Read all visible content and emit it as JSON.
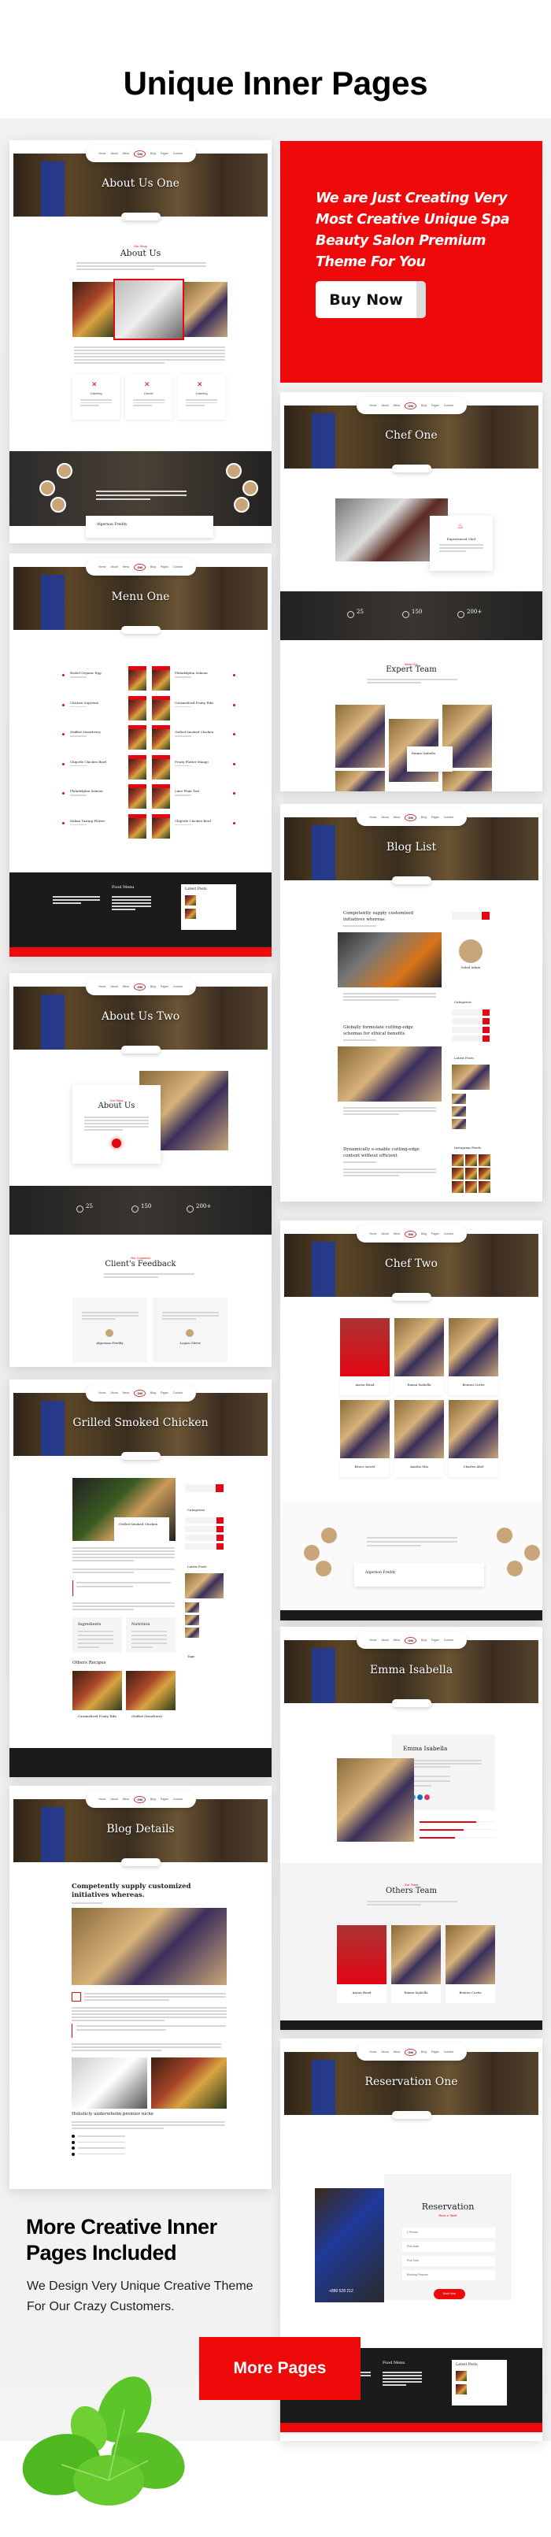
{
  "header": {
    "title": "Unique Inner Pages"
  },
  "promo": {
    "text": "We are Just Creating Very Most Creative Unique Spa Beauty Salon Premium Theme For You",
    "button": "Buy Now",
    "color": "#ee0a0a"
  },
  "nav": [
    "Home",
    "About",
    "Menu",
    "Blog",
    "Pages",
    "Contact"
  ],
  "pages": {
    "about_one": {
      "title": "About Us One",
      "tag": "Our Story",
      "heading": "About Us",
      "features": [
        "Catering",
        "Dinner",
        "Catering"
      ],
      "person": "Algernon Freddy"
    },
    "menu_one": {
      "title": "Menu One",
      "left_items": [
        "Boiled Organic Egg",
        "Chicken Supreme",
        "Stuffed Strawberry",
        "Chipotle Chicken Bowl",
        "Philadelphia Salmon",
        "Italian Tasting Platter"
      ],
      "right_items": [
        "Philadelphia Salmon",
        "Caramelized Fruity Ribs",
        "Grilled Smoked Chicken",
        "Fruity Platter Mango",
        "Lime Plum Tart",
        "Chipotle Chicken Bowl"
      ],
      "footer_menu": "Food Menu",
      "footer_posts": "Latest Posts"
    },
    "about_two": {
      "title": "About Us Two",
      "tag": "Our Story",
      "heading": "About Us",
      "stats": [
        "25",
        "150",
        "200+"
      ],
      "feedback_tag": "Our Customer",
      "feedback": "Client's Feedback",
      "people": [
        "Algernon Freddy",
        "Logan Oliver"
      ]
    },
    "grilled": {
      "title": "Grilled Smoked Chicken",
      "card_title": "Grilled Smoked Chicken",
      "categories": "Categories",
      "latest": "Latest Posts",
      "tags": "Tags",
      "ingredients": "Ingredients",
      "nutrition": "Nutrition",
      "others": "Others Recipes",
      "recipes": [
        "Caramelized Fruity Ribs",
        "Stuffed Strawberry"
      ],
      "footer_menu": "Food Menu",
      "footer_posts": "Latest Posts"
    },
    "blog_details": {
      "title": "Blog Details",
      "heading": "Competently supply customized initiatives whereas.",
      "subheading": "Holisticly underwhelm premier niche"
    },
    "chef_one": {
      "title": "Chef One",
      "card": "Experienced Chef",
      "stats": [
        "25",
        "150",
        "200+"
      ],
      "team_tag": "Meet Our",
      "team": "Expert Team",
      "featured": "Emma Isabella"
    },
    "blog_list": {
      "title": "Blog List",
      "posts": [
        "Competently supply customized initiatives whereas",
        "Globally formulate cutting-edge schemas for ethical benefits",
        "Dynamically e-enable cutting-edge content without efficient"
      ],
      "author": "Sohel Adam",
      "categories": "Categories",
      "latest": "Latest Posts",
      "instagram": "Instagram Feeds"
    },
    "chef_two": {
      "title": "Chef Two",
      "chefs": [
        "Aaron Bond",
        "Emma Isabella",
        "Benton Curtis",
        "Bruce Aewel",
        "Amelia Mia",
        "Charles Abel"
      ],
      "person": "Algernon Freddy"
    },
    "emma": {
      "title": "Emma Isabella",
      "name": "Emma Isabella",
      "skills": [
        75,
        58,
        47
      ],
      "team_tag": "Our Team",
      "team": "Others Team",
      "chefs": [
        "Aaron Bond",
        "Emma Isabella",
        "Benton Curtis"
      ]
    },
    "reservation": {
      "title": "Reservation One",
      "heading": "Reservation",
      "tag": "Book a Table",
      "fields": [
        "2 Person",
        "Pick Date",
        "Pick Time",
        "Booking Purpose"
      ],
      "button": "Book Now",
      "phone": "+880 528 212",
      "footer_menu": "Food Menu",
      "footer_posts": "Latest Posts"
    }
  },
  "more": {
    "heading": "More Creative Inner Pages Included",
    "text": "We Design Very Unique Creative Theme For Our Crazy Customers.",
    "button": "More Pages"
  }
}
